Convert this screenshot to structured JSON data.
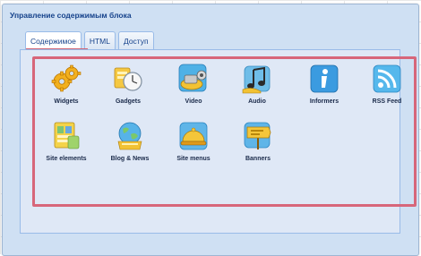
{
  "dialog": {
    "title": "Управление содержимым блока"
  },
  "tabs": [
    {
      "label": "Содержимое",
      "active": true
    },
    {
      "label": "HTML",
      "active": false
    },
    {
      "label": "Доступ",
      "active": false
    }
  ],
  "icons": [
    {
      "label": "Widgets",
      "icon": "gears-icon"
    },
    {
      "label": "Gadgets",
      "icon": "clock-gadget-icon"
    },
    {
      "label": "Video",
      "icon": "video-camera-icon"
    },
    {
      "label": "Audio",
      "icon": "music-note-icon"
    },
    {
      "label": "Informers",
      "icon": "info-icon"
    },
    {
      "label": "RSS Feed",
      "icon": "rss-icon"
    },
    {
      "label": "Site elements",
      "icon": "site-elements-icon"
    },
    {
      "label": "Blog & News",
      "icon": "globe-news-icon"
    },
    {
      "label": "Site menus",
      "icon": "cloche-icon"
    },
    {
      "label": "Banners",
      "icon": "banner-sign-icon"
    }
  ],
  "colors": {
    "highlight_frame": "#d7667a",
    "dialog_bg": "#cfe0f3",
    "title_text": "#15428b"
  }
}
